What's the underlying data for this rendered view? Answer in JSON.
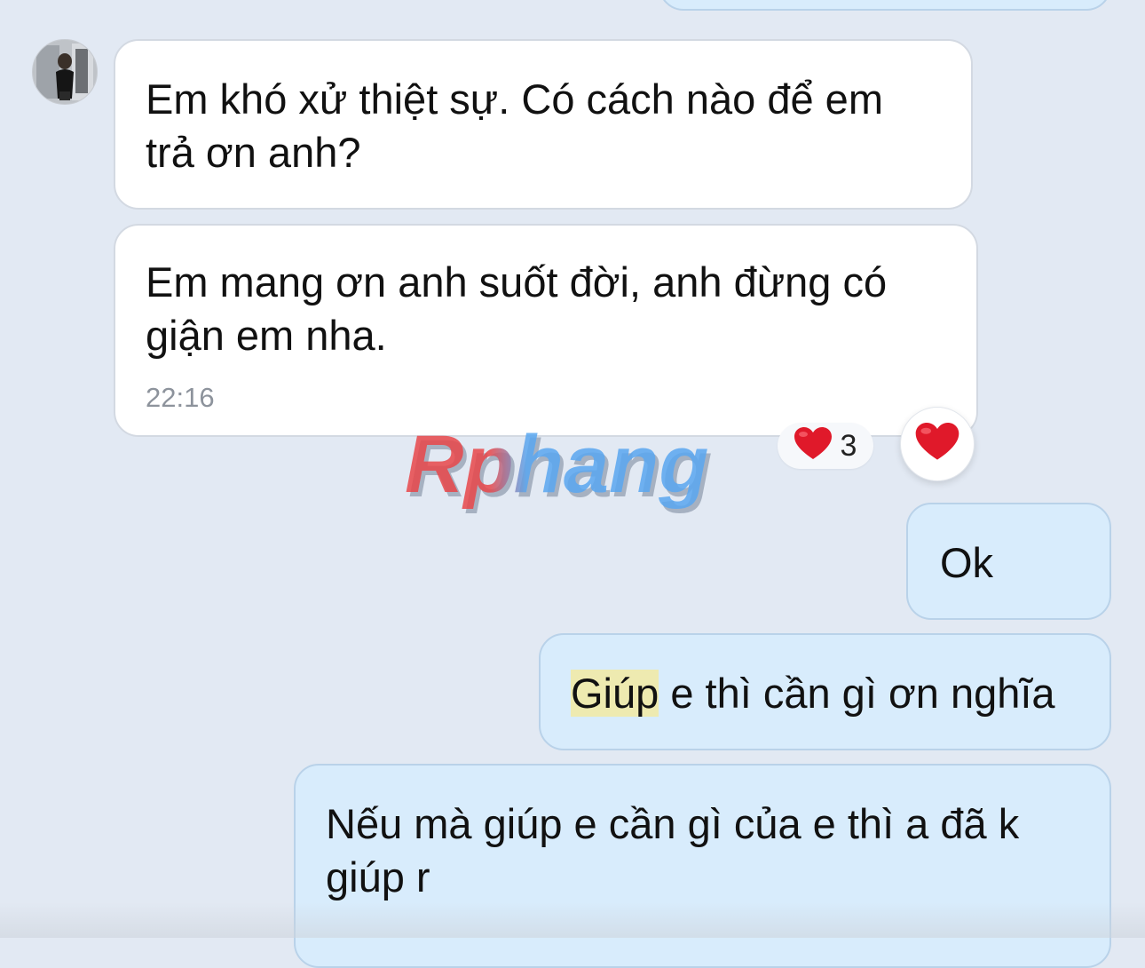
{
  "conversation": {
    "contact_avatar_icon": "contact-avatar-photo",
    "messages": [
      {
        "id": "m0",
        "direction": "outgoing",
        "text": ""
      },
      {
        "id": "m1",
        "direction": "incoming",
        "text": "Em khó xử thiệt sự. Có cách nào để em trả ơn anh?"
      },
      {
        "id": "m2",
        "direction": "incoming",
        "text": "Em mang ơn anh suốt đời, anh đừng có giận em nha.",
        "time": "22:16",
        "reaction": {
          "icon": "heart-icon",
          "count": "3"
        }
      },
      {
        "id": "m3",
        "direction": "outgoing",
        "text": "Ok"
      },
      {
        "id": "m4",
        "direction": "outgoing",
        "highlighted_word": "Giúp",
        "text_rest": " e thì cần gì ơn nghĩa"
      },
      {
        "id": "m5",
        "direction": "outgoing",
        "text": "Nếu mà giúp e cần gì của e thì a đã k giúp r"
      }
    ],
    "react_button_icon": "heart-icon"
  },
  "watermark": {
    "text": "Rphang"
  },
  "colors": {
    "background": "#e2e9f3",
    "incoming_bubble": "#ffffff",
    "outgoing_bubble": "#d8ecfc",
    "heart": "#e0192a",
    "highlight": "#eeeab0",
    "timestamp": "#8d939c"
  }
}
